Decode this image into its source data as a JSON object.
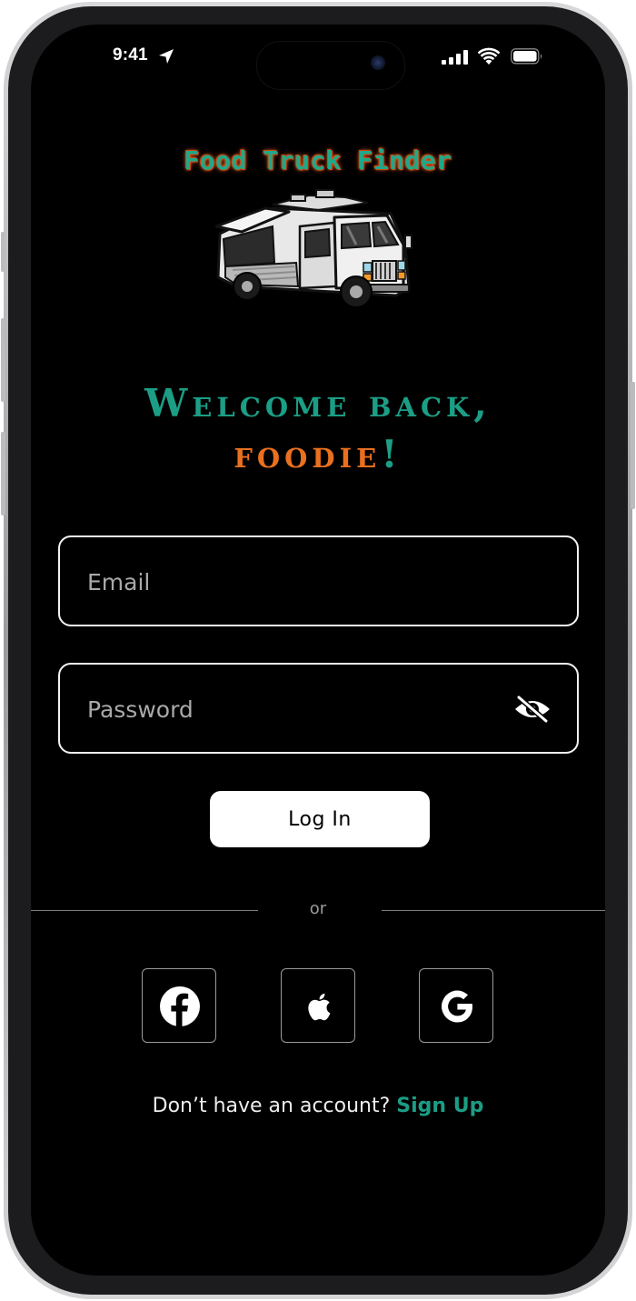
{
  "status_bar": {
    "time": "9:41"
  },
  "logo": {
    "title": "Food Truck Finder"
  },
  "welcome": {
    "line1": "Welcome back,",
    "line2_word": "foodie",
    "line2_punct": "!"
  },
  "form": {
    "email_placeholder": "Email",
    "password_placeholder": "Password",
    "login_label": "Log In"
  },
  "divider": {
    "label": "or"
  },
  "social": [
    "facebook-icon",
    "apple-icon",
    "google-icon"
  ],
  "signup": {
    "prompt": "Don’t have an account?",
    "link": "Sign Up"
  },
  "colors": {
    "teal": "#1b9e85",
    "orange": "#e8701f",
    "background": "#000000"
  }
}
